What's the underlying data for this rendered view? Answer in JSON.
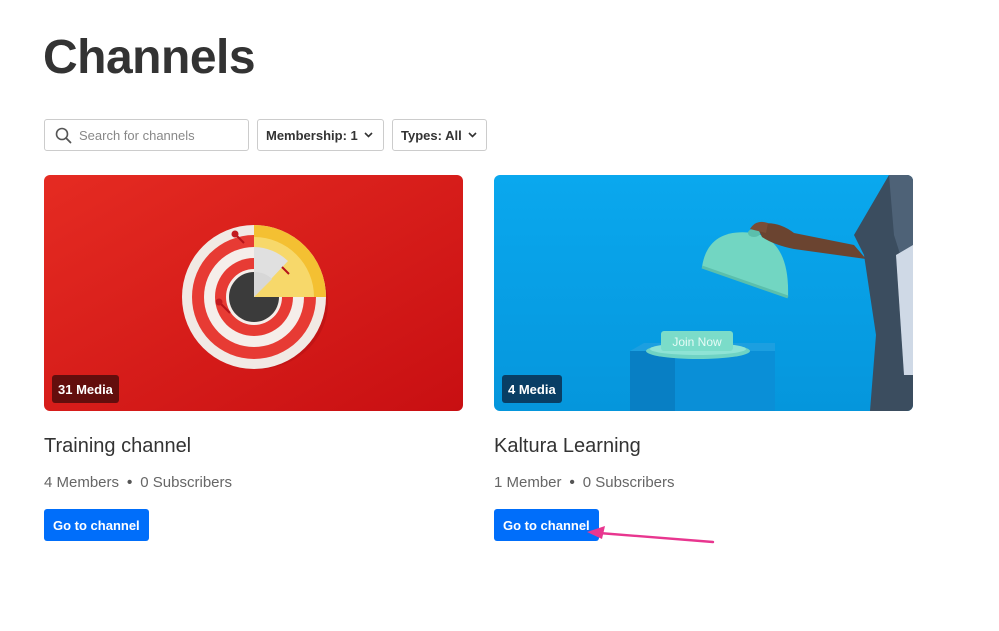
{
  "page": {
    "title": "Channels"
  },
  "filters": {
    "search_placeholder": "Search for channels",
    "membership_label": "Membership: 1",
    "types_label": "Types: All"
  },
  "channels": [
    {
      "media_count": "31 Media",
      "name": "Training channel",
      "members": "4 Members",
      "subscribers": "0 Subscribers",
      "button_label": "Go to channel"
    },
    {
      "media_count": "4 Media",
      "name": "Kaltura Learning",
      "members": "1 Member",
      "subscribers": "0 Subscribers",
      "button_label": "Go to channel",
      "thumbnail_text": "Join Now"
    }
  ],
  "colors": {
    "primary_button": "#006efa",
    "annotation_arrow": "#e8368f",
    "card1_bg": "#d9231d",
    "card2_bg": "#05a6ea"
  },
  "icons": [
    "search-icon",
    "chevron-down-icon",
    "arrow-annotation"
  ]
}
